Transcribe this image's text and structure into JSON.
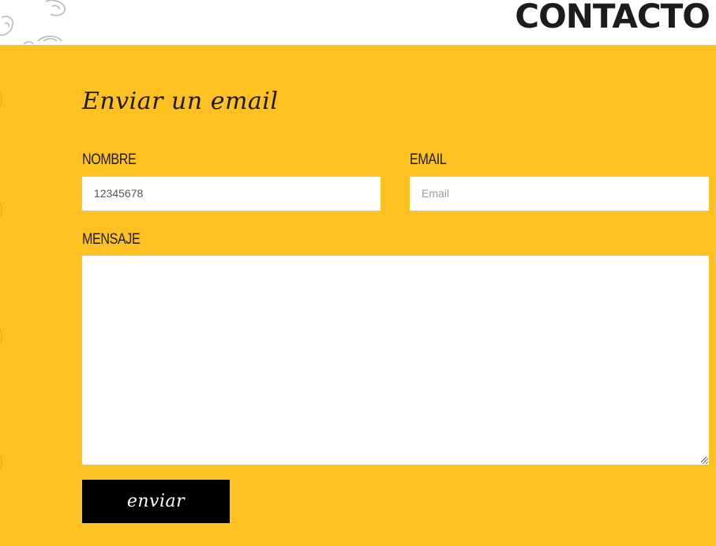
{
  "header": {
    "title": "CONTACTO"
  },
  "form": {
    "heading": "Enviar un email",
    "nombre_label": "NOMBRE",
    "nombre_value": "12345678",
    "email_label": "EMAIL",
    "email_placeholder": "Email",
    "mensaje_label": "MENSAJE",
    "mensaje_value": "",
    "submit_label": "enviar"
  },
  "colors": {
    "section_background": "#fdc221",
    "button_background": "#000000",
    "input_background": "#ffffff",
    "title_color": "#1c1c1c"
  }
}
